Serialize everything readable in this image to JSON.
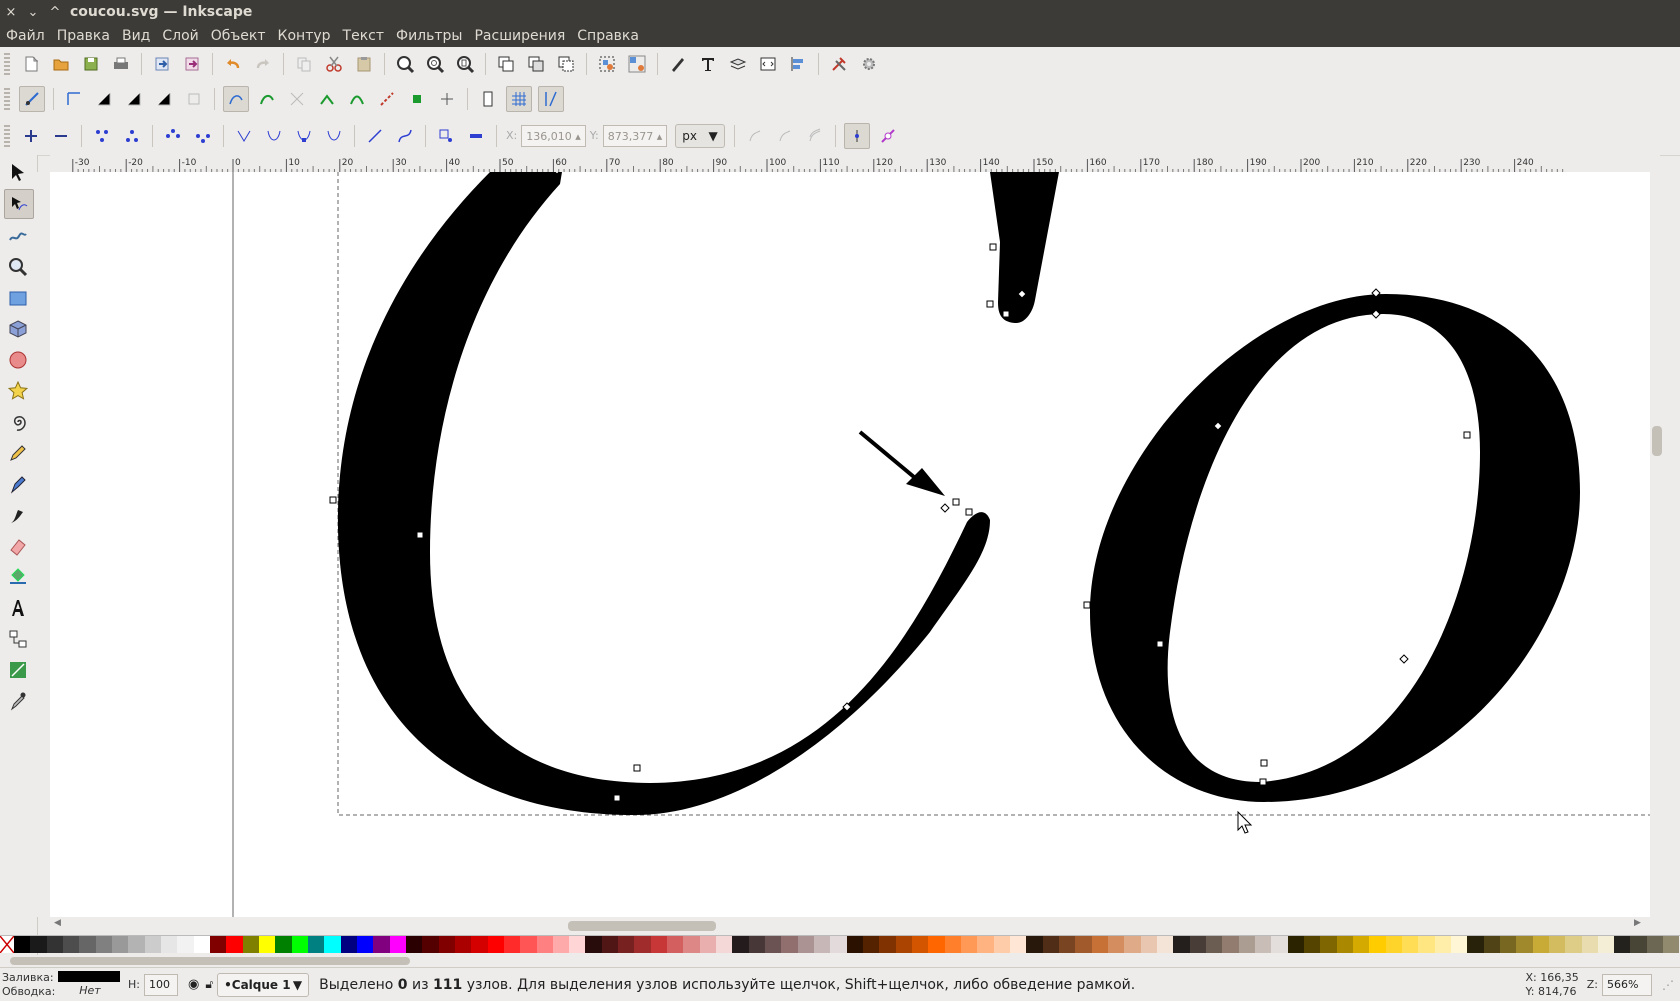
{
  "window": {
    "title": "coucou.svg — Inkscape",
    "close_glyph": "×",
    "min_glyph": "⌄",
    "max_glyph": "^"
  },
  "menu": [
    "Файл",
    "Правка",
    "Вид",
    "Слой",
    "Объект",
    "Контур",
    "Текст",
    "Фильтры",
    "Расширения",
    "Справка"
  ],
  "toolbar_main": {
    "icons": [
      "new-document-icon",
      "open-icon",
      "save-icon",
      "print-icon",
      "import-icon",
      "export-icon",
      "undo-icon",
      "redo-icon",
      "copy-icon",
      "cut-icon",
      "paste-icon",
      "zoom-selection-icon",
      "zoom-drawing-icon",
      "zoom-page-icon",
      "duplicate-icon",
      "clone-icon",
      "unlink-clone-icon",
      "group-icon",
      "ungroup-icon",
      "fill-stroke-icon",
      "text-font-icon",
      "layers-icon",
      "xml-editor-icon",
      "align-icon",
      "preferences-icon",
      "document-properties-icon"
    ]
  },
  "toolbar_snap": {
    "icons": [
      "snap-toggle-icon",
      "snap-bbox-icon",
      "snap-bbox-edge-icon",
      "snap-bbox-corner-icon",
      "snap-bbox-midpoint-icon",
      "snap-bbox-center-icon",
      "snap-nodes-icon",
      "snap-paths-icon",
      "snap-intersection-icon",
      "snap-cusp-icon",
      "snap-smooth-icon",
      "snap-line-midpoint-icon",
      "snap-object-midpoint-icon",
      "snap-rotation-center-icon",
      "snap-page-icon",
      "snap-grid-icon",
      "snap-guide-icon"
    ]
  },
  "toolbar_node": {
    "x_label": "X:",
    "x_value": "136,010",
    "y_label": "Y:",
    "y_value": "873,377",
    "unit": "px"
  },
  "ruler": {
    "ticks": [
      "-30",
      "-20",
      "-10",
      "0",
      "10",
      "20",
      "30",
      "40",
      "50",
      "60",
      "70",
      "80",
      "90",
      "100",
      "110",
      "120",
      "130",
      "140",
      "150",
      "160",
      "170",
      "180",
      "190",
      "200",
      "210",
      "220",
      "230",
      "240"
    ]
  },
  "tools": [
    "selector-arrow-icon",
    "node-editor-icon",
    "tweak-icon",
    "zoom-icon",
    "rectangle-icon",
    "3d-box-icon",
    "ellipse-icon",
    "star-icon",
    "spiral-icon",
    "pencil-icon",
    "pen-icon",
    "calligraphy-icon",
    "eraser-icon",
    "paint-bucket-icon",
    "text-tool-icon",
    "connector-icon",
    "gradient-icon",
    "dropper-icon"
  ],
  "status": {
    "fill_label": "Заливка:",
    "stroke_label": "Обводка:",
    "stroke_value": "Нет",
    "opacity_label": "Н:",
    "opacity_value": "100",
    "layer": "•Calque 1",
    "message_prefix": "Выделено",
    "selected_count": "0",
    "message_mid": "из",
    "total_count": "111",
    "message_suffix": "узлов.  Для выделения узлов используйте щелчок, Shift+щелчок, либо обведение рамкой.",
    "x_label": "X:",
    "x_value": "166,35",
    "y_label": "Y:",
    "y_value": "814,76",
    "zoom_label": "Z:",
    "zoom_value": "566%"
  },
  "palette": [
    "#000000",
    "#1a1a1a",
    "#333333",
    "#4d4d4d",
    "#666666",
    "#808080",
    "#999999",
    "#b3b3b3",
    "#cccccc",
    "#e6e6e6",
    "#f2f2f2",
    "#ffffff",
    "#800000",
    "#ff0000",
    "#808000",
    "#ffff00",
    "#008000",
    "#00ff00",
    "#008080",
    "#00ffff",
    "#000080",
    "#0000ff",
    "#800080",
    "#ff00ff",
    "#2b0000",
    "#550000",
    "#800000",
    "#aa0000",
    "#d40000",
    "#ff0000",
    "#ff2a2a",
    "#ff5555",
    "#ff8080",
    "#ffaaaa",
    "#ffd5d5",
    "#280b0b",
    "#501616",
    "#782121",
    "#a02c2c",
    "#c83737",
    "#d35f5f",
    "#de8787",
    "#e9afaf",
    "#f4d7d7",
    "#241c1c",
    "#483737",
    "#6c5353",
    "#916f6f",
    "#ac9393",
    "#c8b7b7",
    "#e3dbdb",
    "#2b1100",
    "#552200",
    "#803300",
    "#aa4400",
    "#d45500",
    "#ff6600",
    "#ff7f2a",
    "#ff9955",
    "#ffb380",
    "#ffccaa",
    "#ffe6d5",
    "#28170b",
    "#502d16",
    "#784421",
    "#a05a2c",
    "#c87137",
    "#d38d5f",
    "#deaa87",
    "#e9c6af",
    "#f4e3d7",
    "#241f1c",
    "#483e37",
    "#6c5d53",
    "#917c6f",
    "#ac9d93",
    "#c8beb7",
    "#e3dedb",
    "#2b2200",
    "#554400",
    "#806600",
    "#aa8800",
    "#d4aa00",
    "#ffcc00",
    "#ffd42a",
    "#ffdd55",
    "#ffe680",
    "#ffeeaa",
    "#fff6d5",
    "#28220b",
    "#504416",
    "#786721",
    "#a0892c",
    "#c8ab37",
    "#d3bc5f",
    "#decd87",
    "#e9ddaf",
    "#f4eed7",
    "#24221c",
    "#484537",
    "#6c6753",
    "#918a6f"
  ]
}
